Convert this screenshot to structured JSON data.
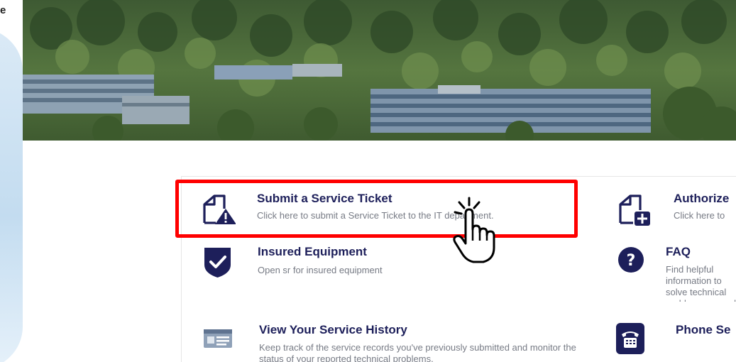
{
  "left_fragment": "e",
  "services": {
    "submit_ticket": {
      "title": "Submit a Service Ticket",
      "desc": "Click here to submit a Service Ticket to the IT department."
    },
    "insured_equipment": {
      "title": "Insured Equipment",
      "desc": "Open sr for insured equipment"
    },
    "service_history": {
      "title": "View Your Service History",
      "desc": "Keep track of the service records you've previously submitted and monitor the status of your reported technical problems."
    },
    "authorize": {
      "title": "Authorize",
      "desc": "Click here to"
    },
    "faq": {
      "title": "FAQ",
      "desc": "Find helpful information to solve technical problems yourself!"
    },
    "phone": {
      "title": "Phone Se",
      "desc": ""
    }
  },
  "colors": {
    "title": "#1d1f5a",
    "highlight": "#ff0000",
    "icon": "#1d1f5a"
  }
}
